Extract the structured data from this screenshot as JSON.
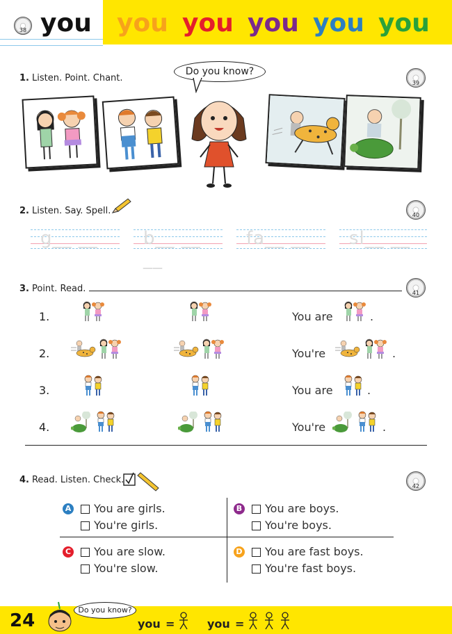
{
  "header": {
    "cd_track": "38",
    "word_main": "you",
    "word_variants": [
      {
        "text": "you",
        "color": "#f7a21b"
      },
      {
        "text": "you",
        "color": "#e41e2b"
      },
      {
        "text": "you",
        "color": "#7b2a8c"
      },
      {
        "text": "you",
        "color": "#2c7fc1"
      },
      {
        "text": "you",
        "color": "#2aa13a"
      }
    ]
  },
  "section1": {
    "number": "1.",
    "title": "Listen. Point. Chant.",
    "bubble": "Do you know?",
    "cd_track": "39"
  },
  "section2": {
    "number": "2.",
    "title": "Listen. Say. Spell.",
    "cd_track": "40",
    "traces": [
      "g__ __",
      "b__ __ __",
      "fa__ __",
      "sl__ __"
    ]
  },
  "section3": {
    "number": "3.",
    "title": "Point. Read.",
    "cd_track": "41",
    "rows": [
      {
        "num": "1.",
        "sentence": "You are",
        "end": "."
      },
      {
        "num": "2.",
        "sentence": "You're",
        "end": "."
      },
      {
        "num": "3.",
        "sentence": "You are",
        "end": "."
      },
      {
        "num": "4.",
        "sentence": "You're",
        "end": "."
      }
    ]
  },
  "section4": {
    "number": "4.",
    "title": "Read. Listen. Check.",
    "cd_track": "42",
    "groups": [
      {
        "letter": "A",
        "color": "#2c7fc1",
        "options": [
          "You are girls.",
          "You're girls."
        ]
      },
      {
        "letter": "B",
        "color": "#8e2a8c",
        "options": [
          "You are boys.",
          "You're boys."
        ]
      },
      {
        "letter": "C",
        "color": "#e41e2b",
        "options": [
          "You are slow.",
          "You're slow."
        ]
      },
      {
        "letter": "D",
        "color": "#f7a21b",
        "options": [
          "You are fast boys.",
          "You're fast boys."
        ]
      }
    ]
  },
  "footer": {
    "page_number": "24",
    "bubble": "Do you know?",
    "eq1_word": "you",
    "eq1_sign": "=",
    "eq2_word": "you",
    "eq2_sign": "="
  }
}
